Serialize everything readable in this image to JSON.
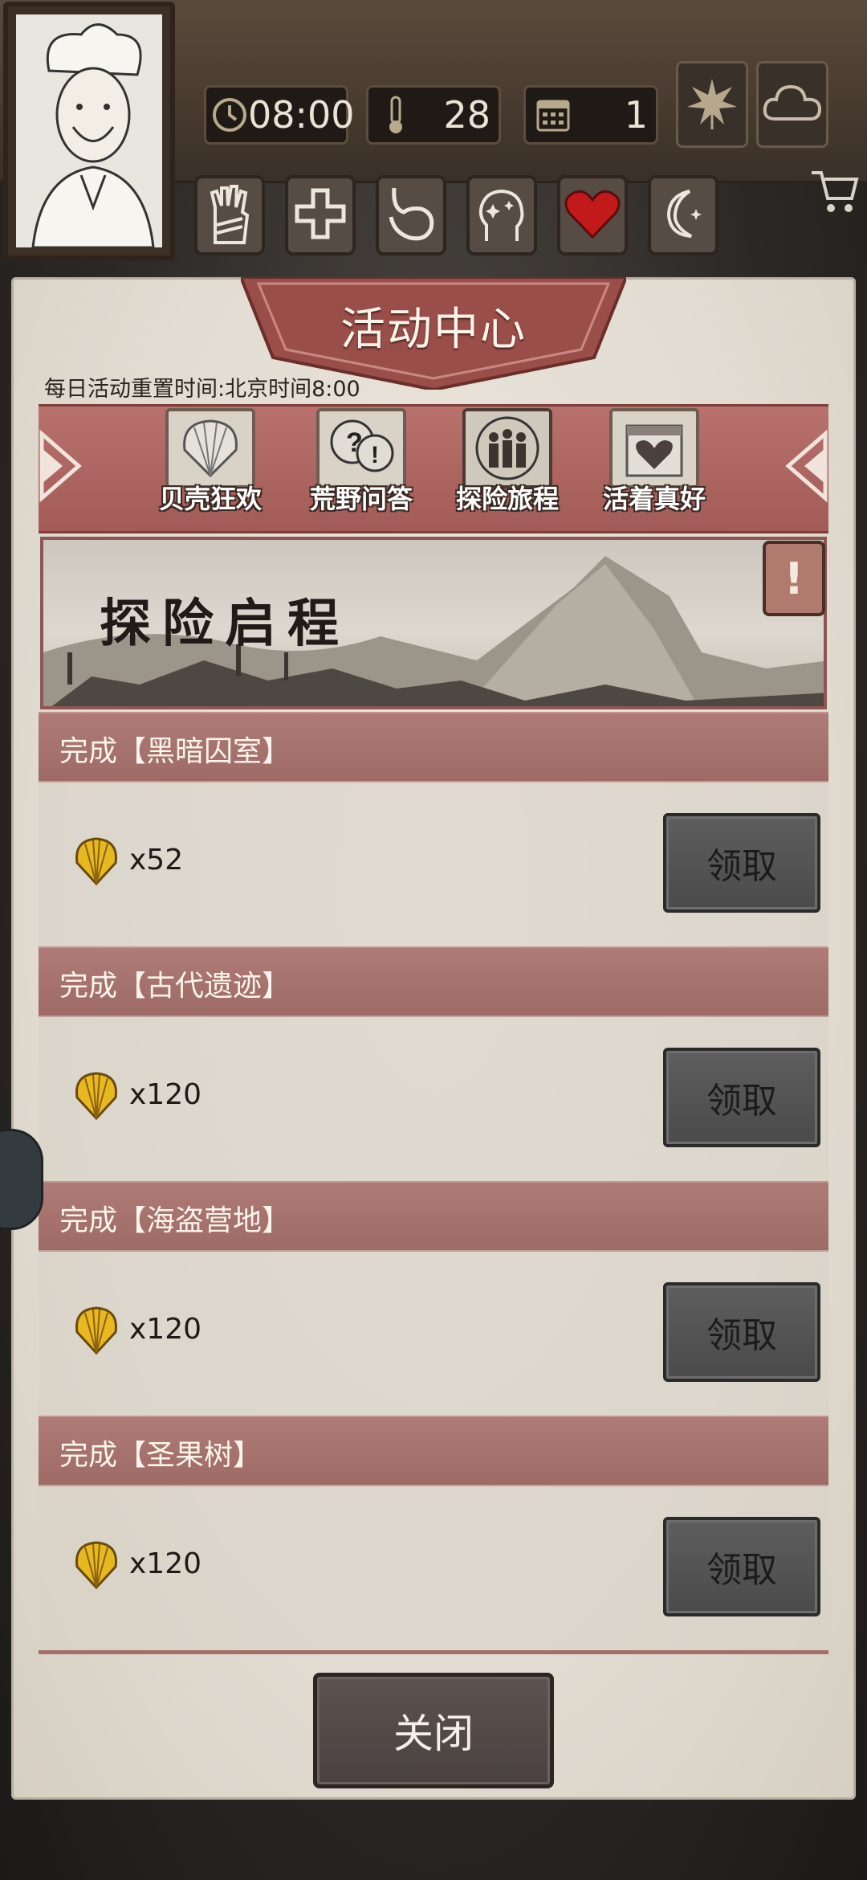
{
  "hud": {
    "time": "08:00",
    "temperature": "28",
    "day": "1",
    "icons": [
      "clock-icon",
      "thermometer-icon",
      "calendar-icon",
      "leaf-icon",
      "cloud-icon"
    ],
    "skills": [
      "bandaged-hand-icon",
      "cross-icon",
      "stomach-icon",
      "head-icon",
      "heart-icon",
      "moon-icon"
    ]
  },
  "panel": {
    "title": "活动中心",
    "reset_note": "每日活动重置时间:北京时间8:00",
    "tabs": [
      {
        "label": "贝壳狂欢",
        "icon": "shell-icon",
        "active": false
      },
      {
        "label": "荒野问答",
        "icon": "question-bubbles-icon",
        "active": false
      },
      {
        "label": "探险旅程",
        "icon": "explorers-icon",
        "active": true
      },
      {
        "label": "活着真好",
        "icon": "heart-calendar-icon",
        "active": false
      }
    ],
    "banner_title": "探险启程",
    "info_symbol": "!",
    "tasks": [
      {
        "label": "完成【黑暗囚室】",
        "reward": "x52",
        "button": "领取"
      },
      {
        "label": "完成【古代遗迹】",
        "reward": "x120",
        "button": "领取"
      },
      {
        "label": "完成【海盗营地】",
        "reward": "x120",
        "button": "领取"
      },
      {
        "label": "完成【圣果树】",
        "reward": "x120",
        "button": "领取"
      }
    ],
    "close": "关闭"
  },
  "colors": {
    "accent_red": "#a25b57",
    "task_header": "#ae7b76",
    "heart_red": "#c21a1a",
    "shell_gold": "#e8b820"
  }
}
